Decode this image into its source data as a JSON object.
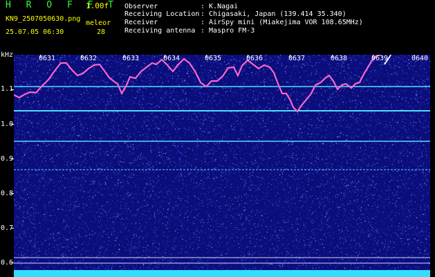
{
  "header": {
    "title": "H R O F F T",
    "version": "1.00f",
    "filename": "KN9_2507050630.png",
    "meteor_label": "meleor",
    "meteor_count": "28",
    "datetime": "25.07.05 06:30"
  },
  "metadata": [
    {
      "label": "Observer",
      "value": ": K.Nagai"
    },
    {
      "label": "Receiving Location",
      "value": ": Chigasaki, Japan (139.414 35.340)"
    },
    {
      "label": "Receiver",
      "value": ": AirSpy mini (Miakejima VOR 108.65MHz)"
    },
    {
      "label": "Receiving antenna",
      "value": ": Maspro FM-3"
    }
  ],
  "axis": {
    "y_unit": "kHz",
    "y_ticks": [
      "1.1",
      "1.0",
      "0.9",
      "0.8",
      "0.7",
      "0.6"
    ],
    "x_ticks": [
      "0631",
      "0632",
      "0633",
      "0634",
      "0635",
      "0636",
      "0637",
      "0638",
      "0639",
      "0640"
    ]
  },
  "colors": {
    "background": "#000000",
    "plot_bg": "#0a0d7a",
    "title_green": "#33ff33",
    "accent_yellow": "#ffff00",
    "trace_magenta": "#ff66cc",
    "line_cyan": "#55ddff"
  }
}
